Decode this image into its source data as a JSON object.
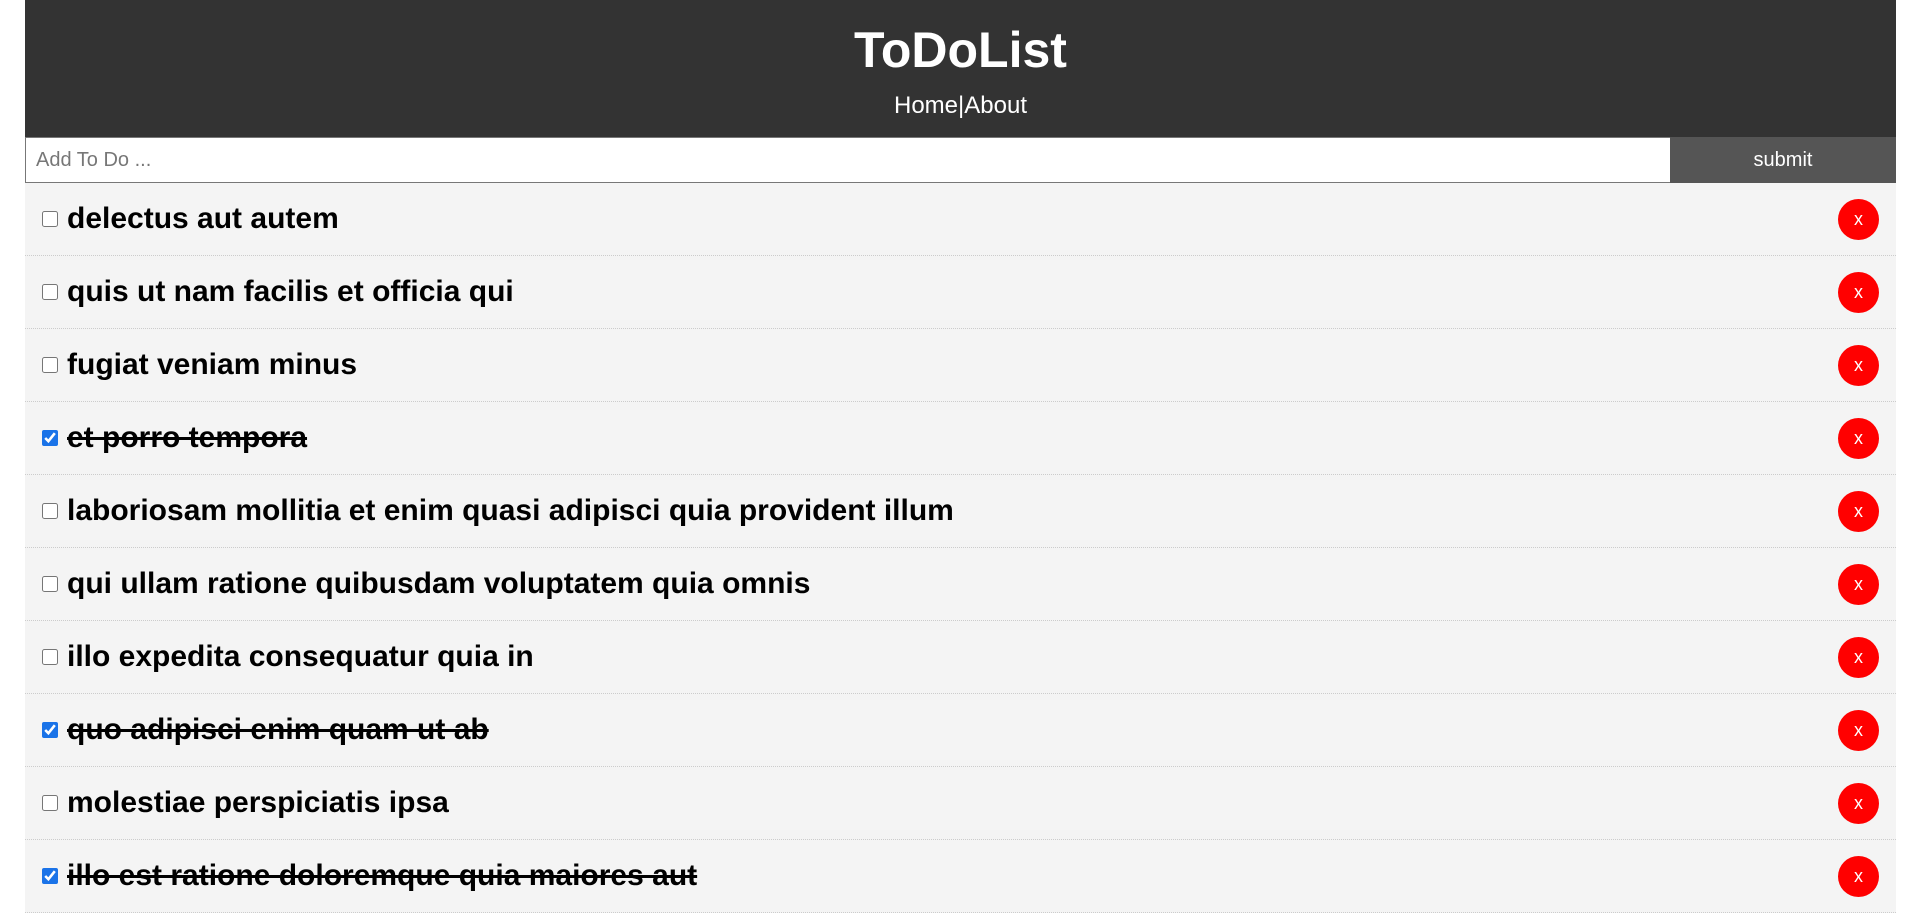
{
  "header": {
    "title": "ToDoList",
    "nav": {
      "home": "Home",
      "separator": "|",
      "about": "About"
    }
  },
  "add_form": {
    "placeholder": "Add To Do ...",
    "value": "",
    "submit_label": "submit"
  },
  "todos": [
    {
      "title": "delectus aut autem",
      "completed": false
    },
    {
      "title": "quis ut nam facilis et officia qui",
      "completed": false
    },
    {
      "title": "fugiat veniam minus",
      "completed": false
    },
    {
      "title": "et porro tempora",
      "completed": true
    },
    {
      "title": "laboriosam mollitia et enim quasi adipisci quia provident illum",
      "completed": false
    },
    {
      "title": "qui ullam ratione quibusdam voluptatem quia omnis",
      "completed": false
    },
    {
      "title": "illo expedita consequatur quia in",
      "completed": false
    },
    {
      "title": "quo adipisci enim quam ut ab",
      "completed": true
    },
    {
      "title": "molestiae perspiciatis ipsa",
      "completed": false
    },
    {
      "title": "illo est ratione doloremque quia maiores aut",
      "completed": true
    }
  ],
  "delete_label": "x",
  "colors": {
    "header_bg": "#333333",
    "submit_bg": "#555555",
    "row_bg": "#f4f4f4",
    "delete_bg": "#ff0000"
  }
}
